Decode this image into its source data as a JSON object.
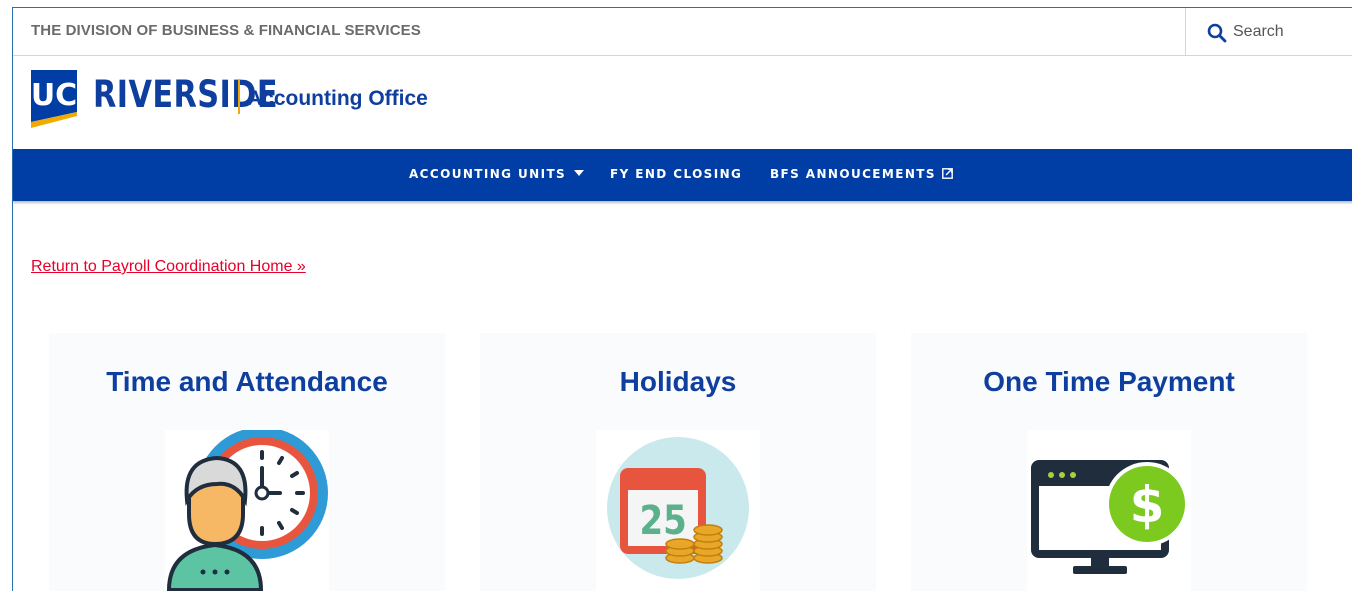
{
  "header": {
    "division": "THE DIVISION OF BUSINESS & FINANCIAL SERVICES",
    "search_placeholder": "Search",
    "logo_letters": "UC",
    "wordmark": "RIVERSIDE",
    "office_name": "Accounting Office"
  },
  "nav": {
    "items": [
      {
        "label": "ACCOUNTING UNITS",
        "icon": "caret-down-icon"
      },
      {
        "label": "FY END CLOSING"
      },
      {
        "label": "BFS ANNOUCEMENTS",
        "icon": "external-link-icon"
      }
    ]
  },
  "main": {
    "return_link": "Return to Payroll Coordination Home »",
    "cards": [
      {
        "title": "Time and Attendance",
        "icon": "clock-person-icon"
      },
      {
        "title": "Holidays",
        "icon": "calendar-coins-icon",
        "calendar_day": "25"
      },
      {
        "title": "One Time Payment",
        "icon": "monitor-dollar-icon"
      }
    ]
  },
  "colors": {
    "brand_blue": "#003da5",
    "brand_gold": "#f1ab00",
    "link_red": "#e8002a",
    "title_blue": "#0f3f9e"
  }
}
